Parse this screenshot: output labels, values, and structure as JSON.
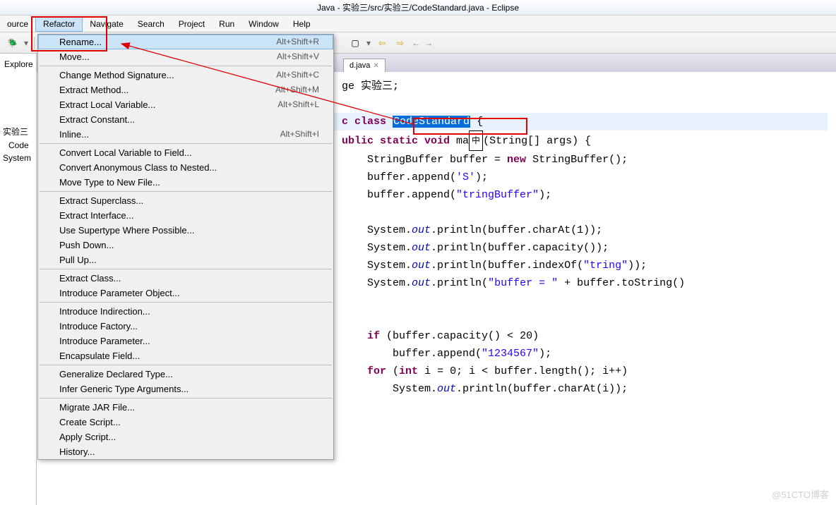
{
  "title": "Java - 实验三/src/实验三/CodeStandard.java - Eclipse",
  "menubar": [
    "ource",
    "Refactor",
    "Navigate",
    "Search",
    "Project",
    "Run",
    "Window",
    "Help"
  ],
  "menubar_selected_index": 1,
  "sidebar": {
    "explorer_label": "Explore",
    "items": [
      "实验三",
      "Code",
      "System"
    ]
  },
  "toolbar": {
    "nav_back": "⇦",
    "nav_fwd": "⇨"
  },
  "dropdown": {
    "groups": [
      [
        {
          "label": "Rename...",
          "shortcut": "Alt+Shift+R",
          "highlighted": true
        },
        {
          "label": "Move...",
          "shortcut": "Alt+Shift+V"
        }
      ],
      [
        {
          "label": "Change Method Signature...",
          "shortcut": "Alt+Shift+C"
        },
        {
          "label": "Extract Method...",
          "shortcut": "Alt+Shift+M"
        },
        {
          "label": "Extract Local Variable...",
          "shortcut": "Alt+Shift+L"
        },
        {
          "label": "Extract Constant...",
          "shortcut": ""
        },
        {
          "label": "Inline...",
          "shortcut": "Alt+Shift+I"
        }
      ],
      [
        {
          "label": "Convert Local Variable to Field...",
          "shortcut": ""
        },
        {
          "label": "Convert Anonymous Class to Nested...",
          "shortcut": ""
        },
        {
          "label": "Move Type to New File...",
          "shortcut": ""
        }
      ],
      [
        {
          "label": "Extract Superclass...",
          "shortcut": ""
        },
        {
          "label": "Extract Interface...",
          "shortcut": ""
        },
        {
          "label": "Use Supertype Where Possible...",
          "shortcut": ""
        },
        {
          "label": "Push Down...",
          "shortcut": ""
        },
        {
          "label": "Pull Up...",
          "shortcut": ""
        }
      ],
      [
        {
          "label": "Extract Class...",
          "shortcut": ""
        },
        {
          "label": "Introduce Parameter Object...",
          "shortcut": ""
        }
      ],
      [
        {
          "label": "Introduce Indirection...",
          "shortcut": ""
        },
        {
          "label": "Introduce Factory...",
          "shortcut": ""
        },
        {
          "label": "Introduce Parameter...",
          "shortcut": ""
        },
        {
          "label": "Encapsulate Field...",
          "shortcut": ""
        }
      ],
      [
        {
          "label": "Generalize Declared Type...",
          "shortcut": ""
        },
        {
          "label": "Infer Generic Type Arguments...",
          "shortcut": ""
        }
      ],
      [
        {
          "label": "Migrate JAR File...",
          "shortcut": ""
        },
        {
          "label": "Create Script...",
          "shortcut": ""
        },
        {
          "label": "Apply Script...",
          "shortcut": ""
        },
        {
          "label": "History...",
          "shortcut": ""
        }
      ]
    ]
  },
  "editor": {
    "tab_label": "d.java",
    "tab_close": "✕",
    "code": {
      "l1_ge": "ge ",
      "l1_pkg": "实验三;",
      "l2_c": "c ",
      "l2_class": "class ",
      "l2_name": "CodeStandard",
      "l2_brace": " {",
      "l3_a": "ublic static void",
      "l3_b": " ma",
      "l3_ime": "中",
      "l3_c": "(String[] args) {",
      "l4": "    StringBuffer buffer = ",
      "l4_new": "new",
      "l4_b": " StringBuffer();",
      "l5a": "    buffer.append(",
      "l5s": "'S'",
      "l5b": ");",
      "l6a": "    buffer.append(",
      "l6s": "\"tringBuffer\"",
      "l6b": ");",
      "l8a": "    System.",
      "l8o": "out",
      "l8b": ".println(buffer.charAt(1));",
      "l9a": "    System.",
      "l9o": "out",
      "l9b": ".println(buffer.capacity());",
      "l10a": "    System.",
      "l10o": "out",
      "l10b": ".println(buffer.indexOf(",
      "l10s": "\"tring\"",
      "l10c": "));",
      "l11a": "    System.",
      "l11o": "out",
      "l11b": ".println(",
      "l11s": "\"buffer = \"",
      "l11c": " + buffer.toString()",
      "l13a": "    ",
      "l13if": "if",
      "l13b": " (buffer.capacity() < 20)",
      "l14a": "        buffer.append(",
      "l14s": "\"1234567\"",
      "l14b": ");",
      "l15a": "    ",
      "l15for": "for",
      "l15b": " (",
      "l15int": "int",
      "l15c": " i = 0; i < buffer.length(); i++)",
      "l16a": "        System.",
      "l16o": "out",
      "l16b": ".println(buffer.charAt(i));"
    }
  },
  "watermark": "@51CTO博客"
}
